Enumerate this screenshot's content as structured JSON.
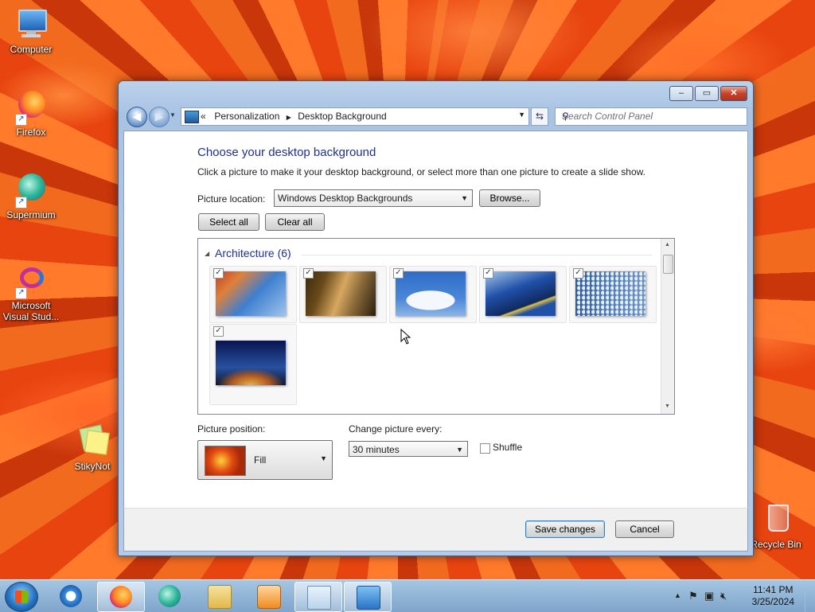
{
  "desktop": {
    "icons": [
      {
        "label": "Computer",
        "icon": "computer-icon"
      },
      {
        "label": "Firefox",
        "icon": "firefox-icon"
      },
      {
        "label": "Supermium",
        "icon": "supermium-icon"
      },
      {
        "label": "Microsoft Visual Stud...",
        "icon": "visual-studio-icon"
      },
      {
        "label": "StikyNot",
        "icon": "sticky-notes-icon"
      },
      {
        "label": "Recycle Bin",
        "icon": "recycle-bin-icon"
      }
    ]
  },
  "window": {
    "address": {
      "prefix": "«",
      "crumb1": "Personalization",
      "sep": "▶",
      "crumb2": "Desktop Background"
    },
    "search_placeholder": "Search Control Panel",
    "caption": {
      "minimize": "–",
      "maximize": "▭",
      "close": "✕"
    },
    "heading": "Choose your desktop background",
    "subtitle": "Click a picture to make it your desktop background, or select more than one picture to create a slide show.",
    "picture_location_label": "Picture location:",
    "picture_location_value": "Windows Desktop Backgrounds",
    "browse_label": "Browse...",
    "select_all_label": "Select all",
    "clear_all_label": "Clear all",
    "gallery": {
      "group_label": "Architecture (6)",
      "tiles": [
        {
          "checked": true,
          "colors": [
            "#c0402a",
            "#3f7fd0"
          ]
        },
        {
          "checked": true,
          "colors": [
            "#6a4a1a",
            "#d7a860"
          ]
        },
        {
          "checked": true,
          "colors": [
            "#4a86d8",
            "#f4f8fc"
          ]
        },
        {
          "checked": true,
          "colors": [
            "#2050a8",
            "#a8c8e8"
          ]
        },
        {
          "checked": true,
          "colors": [
            "#4c7ebc",
            "#e6eef6"
          ]
        },
        {
          "checked": true,
          "colors": [
            "#0a1450",
            "#e8b048"
          ]
        }
      ]
    },
    "picture_position_label": "Picture position:",
    "picture_position_value": "Fill",
    "change_every_label": "Change picture every:",
    "change_every_value": "30 minutes",
    "shuffle_label": "Shuffle",
    "shuffle_checked": false,
    "save_label": "Save changes",
    "cancel_label": "Cancel"
  },
  "taskbar": {
    "apps": [
      "internet-explorer-icon",
      "firefox-icon",
      "supermium-icon",
      "file-explorer-icon",
      "media-player-icon",
      "notepad-icon",
      "control-panel-icon"
    ],
    "active_app": "firefox-icon",
    "clock_time": "11:41 PM",
    "clock_date": "3/25/2024"
  }
}
